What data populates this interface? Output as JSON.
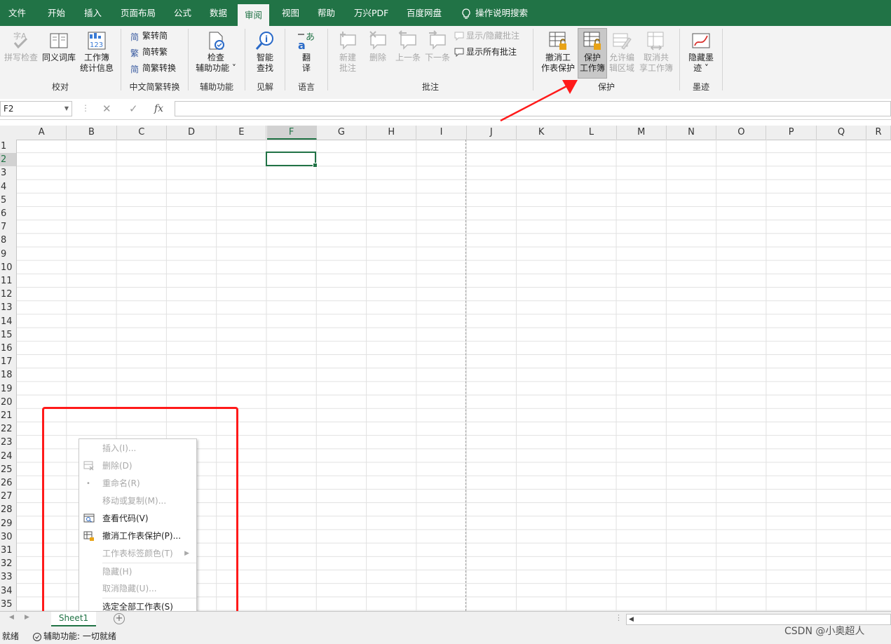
{
  "menu": {
    "tabs": [
      "文件",
      "开始",
      "插入",
      "页面布局",
      "公式",
      "数据",
      "审阅",
      "视图",
      "帮助",
      "万兴PDF",
      "百度网盘"
    ],
    "active_tab": "审阅",
    "tell_me": "操作说明搜索"
  },
  "ribbon": {
    "proofing": {
      "spell": "拼写检查",
      "thesaurus": "同义词库",
      "stats_1": "工作簿",
      "stats_2": "统计信息",
      "group": "校对"
    },
    "chinese": {
      "t2s": "繁转简",
      "s2t": "简转繁",
      "convert": "简繁转换",
      "group": "中文简繁转换"
    },
    "accessibility": {
      "check_1": "检查",
      "check_2": "辅助功能",
      "group": "辅助功能"
    },
    "insights": {
      "smart_1": "智能",
      "smart_2": "查找",
      "group": "见解"
    },
    "language": {
      "translate_1": "翻",
      "translate_2": "译",
      "group": "语言"
    },
    "comments": {
      "new_1": "新建",
      "new_2": "批注",
      "delete": "删除",
      "prev": "上一条",
      "next": "下一条",
      "show_hide": "显示/隐藏批注",
      "show_all": "显示所有批注",
      "group": "批注"
    },
    "protect": {
      "unprotect_sheet_1": "撤消工",
      "unprotect_sheet_2": "作表保护",
      "protect_wb_1": "保护",
      "protect_wb_2": "工作簿",
      "allow_edit_1": "允许编",
      "allow_edit_2": "辑区域",
      "unshare_1": "取消共",
      "unshare_2": "享工作簿",
      "group": "保护"
    },
    "ink": {
      "hide_ink_1": "隐藏墨",
      "hide_ink_2": "迹",
      "group": "墨迹"
    }
  },
  "formula_bar": {
    "name_box": "F2",
    "fx": "fx",
    "value": ""
  },
  "grid": {
    "columns": [
      "A",
      "B",
      "C",
      "D",
      "E",
      "F",
      "G",
      "H",
      "I",
      "J",
      "K",
      "L",
      "M",
      "N",
      "O",
      "P",
      "Q",
      "R"
    ],
    "rows": [
      "1",
      "2",
      "3",
      "4",
      "5",
      "6",
      "7",
      "8",
      "9",
      "10",
      "11",
      "12",
      "13",
      "14",
      "15",
      "16",
      "17",
      "18",
      "19",
      "20",
      "21",
      "22",
      "23",
      "24",
      "25",
      "26",
      "27",
      "28",
      "29",
      "30",
      "31",
      "32",
      "33",
      "34",
      "35"
    ],
    "active_cell": "F2",
    "selected_column": "F",
    "selected_row": "2"
  },
  "context_menu": {
    "items": [
      {
        "label": "插入(I)...",
        "enabled": false
      },
      {
        "label": "删除(D)",
        "enabled": false
      },
      {
        "label": "重命名(R)",
        "enabled": false
      },
      {
        "label": "移动或复制(M)...",
        "enabled": false
      },
      {
        "label": "查看代码(V)",
        "enabled": true
      },
      {
        "label": "撤消工作表保护(P)...",
        "enabled": true
      },
      {
        "label": "工作表标签颜色(T)",
        "enabled": false
      },
      {
        "label": "隐藏(H)",
        "enabled": false
      },
      {
        "label": "取消隐藏(U)...",
        "enabled": false
      },
      {
        "label": "选定全部工作表(S)",
        "enabled": true
      }
    ]
  },
  "sheet_tabs": {
    "active": "Sheet1",
    "add": "+"
  },
  "status": {
    "ready": "就绪",
    "accessibility": "辅助功能: 一切就绪"
  },
  "watermark": "CSDN @小奥超人",
  "colors": {
    "excel_green": "#217346",
    "annotation_red": "#ff1a1a"
  }
}
